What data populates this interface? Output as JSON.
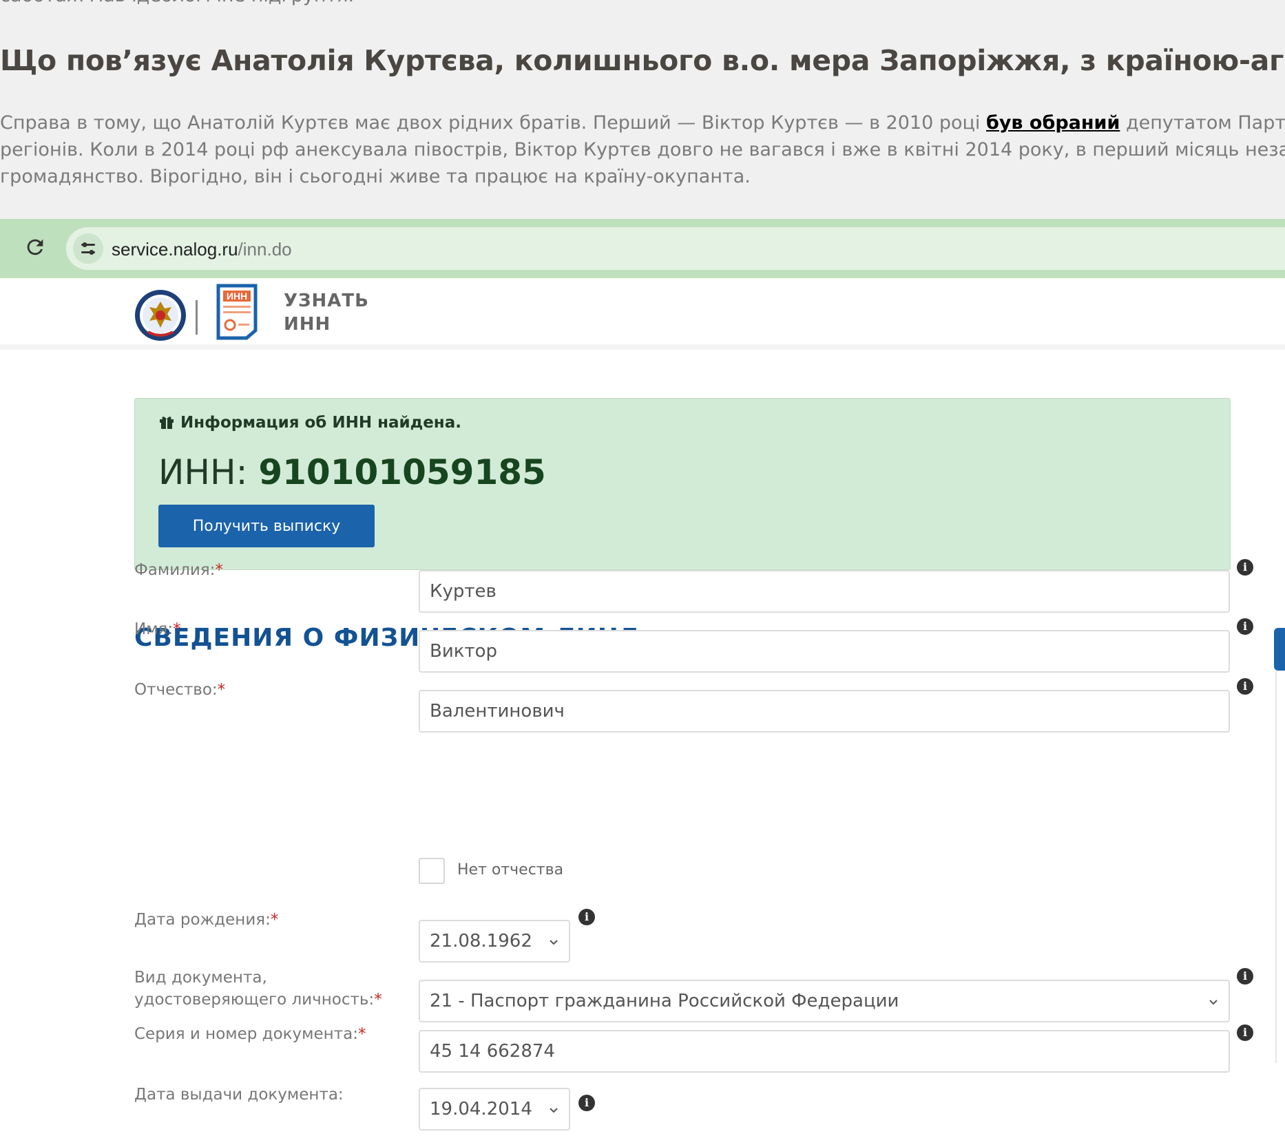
{
  "article": {
    "cut_line": "саботаж мав ідеологічне підґрунтя.",
    "heading": "Що пов’язує Анатолія Куртєва, колишнього в.о. мера Запоріжжя, з країною-агресоркою",
    "para_line1_before": "Справа в тому, що Анатолій Куртєв має двох рідних братів. Перший — Віктор Куртєв — в 2010 році ",
    "para_line1_link": "був обраний",
    "para_line1_after": " депутатом Партії",
    "para_line2": "регіонів. Коли в 2014 році рф анексувала півострів, Віктор Куртєв довго не вагався і вже в квітні 2014 року, в перший місяць незаконної",
    "para_line3": "громадянство. Вірогідно, він і сьогодні живе та працює на країну-окупанта."
  },
  "browser": {
    "url_host": "service.nalog.ru",
    "url_path": "/inn.do",
    "icons": [
      "reload-icon",
      "tune-icon"
    ]
  },
  "site": {
    "brand_line1": "УЗНАТЬ",
    "brand_line2": "ИНН",
    "logo_text": "ИНН",
    "icons": [
      "emblem-icon",
      "inn-logo-icon"
    ]
  },
  "result": {
    "message": "Информация об ИНН найдена.",
    "inn_label": "ИНН: ",
    "inn_number": "910101059185",
    "button_label": "Получить выписку"
  },
  "form": {
    "title": "СВЕДЕНИЯ О ФИЗИЧЕСКОМ ЛИЦЕ",
    "required_mark": "*",
    "surname_label": "Фамилия:",
    "surname_value": "Куртев",
    "name_label": "Имя:",
    "name_value": "Виктор",
    "patronymic_label": "Отчество:",
    "patronymic_value": "Валентинович",
    "no_patronymic_label": "Нет отчества",
    "no_patronymic_checked": false,
    "birth_label": "Дата рождения:",
    "birth_value": "21.08.1962",
    "doctype_label_line1": "Вид документа,",
    "doctype_label_line2": "удостоверяющего личность:",
    "doctype_value": "21 - Паспорт гражданина Российской Федерации",
    "docnum_label": "Серия и номер документа:",
    "docnum_value": "45 14 662874",
    "issue_label": "Дата выдачи документа:",
    "issue_value": "19.04.2014",
    "info_glyph": "i"
  },
  "colors": {
    "browser_bar": "#bfe0bd",
    "success_panel": "#d2ebd6",
    "primary_button": "#1b63ab",
    "section_title": "#135293",
    "required": "#c62828"
  }
}
